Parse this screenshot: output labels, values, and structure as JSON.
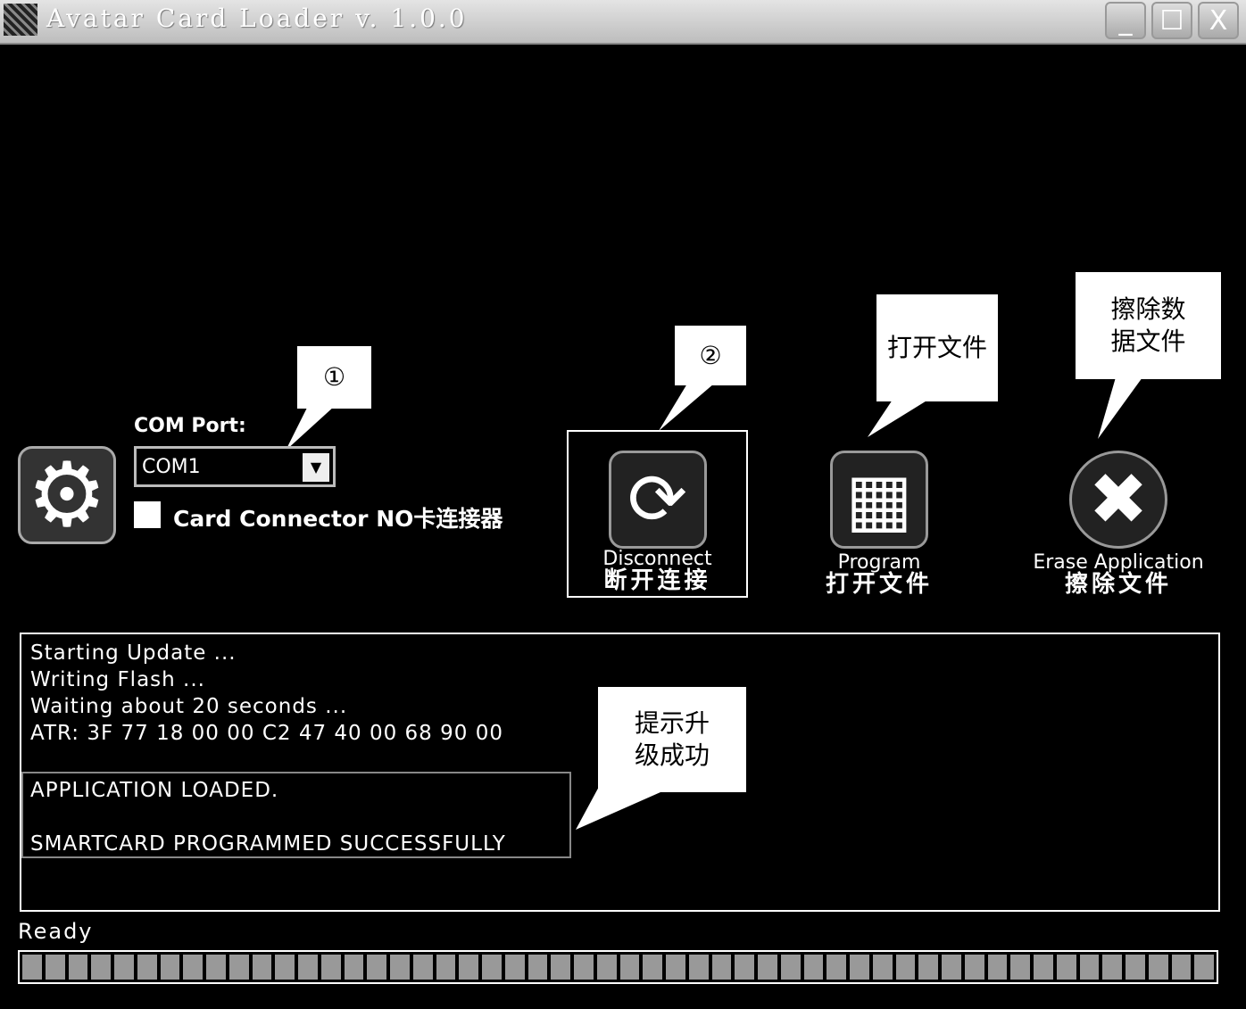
{
  "window": {
    "title": "Avatar Card Loader v. 1.0.0",
    "minimize": "_",
    "maximize": "☐",
    "close": "X"
  },
  "settings": {
    "com_label": "COM Port:",
    "com_value": "COM1",
    "checkbox_label": "Card Connector NO卡连接器",
    "checkbox_checked": false
  },
  "buttons": {
    "disconnect": {
      "label": "Disconnect",
      "cn": "断开连接"
    },
    "program": {
      "label": "Program",
      "cn": "打开文件"
    },
    "erase": {
      "label": "Erase Application",
      "cn": "擦除文件"
    }
  },
  "callouts": {
    "c1": "①",
    "c2": "②",
    "open": "打开文件",
    "erase": "擦除数据文件",
    "success": "提示升级成功"
  },
  "log": {
    "lines": [
      "Starting Update ...",
      "Writing Flash ...",
      "Waiting about 20 seconds ...",
      "ATR:  3F 77 18 00 00 C2 47 40 00 68 90 00"
    ],
    "result": [
      "APPLICATION LOADED.",
      "SMARTCARD PROGRAMMED SUCCESSFULLY"
    ]
  },
  "status": {
    "text": "Ready",
    "progress_percent": 100
  }
}
